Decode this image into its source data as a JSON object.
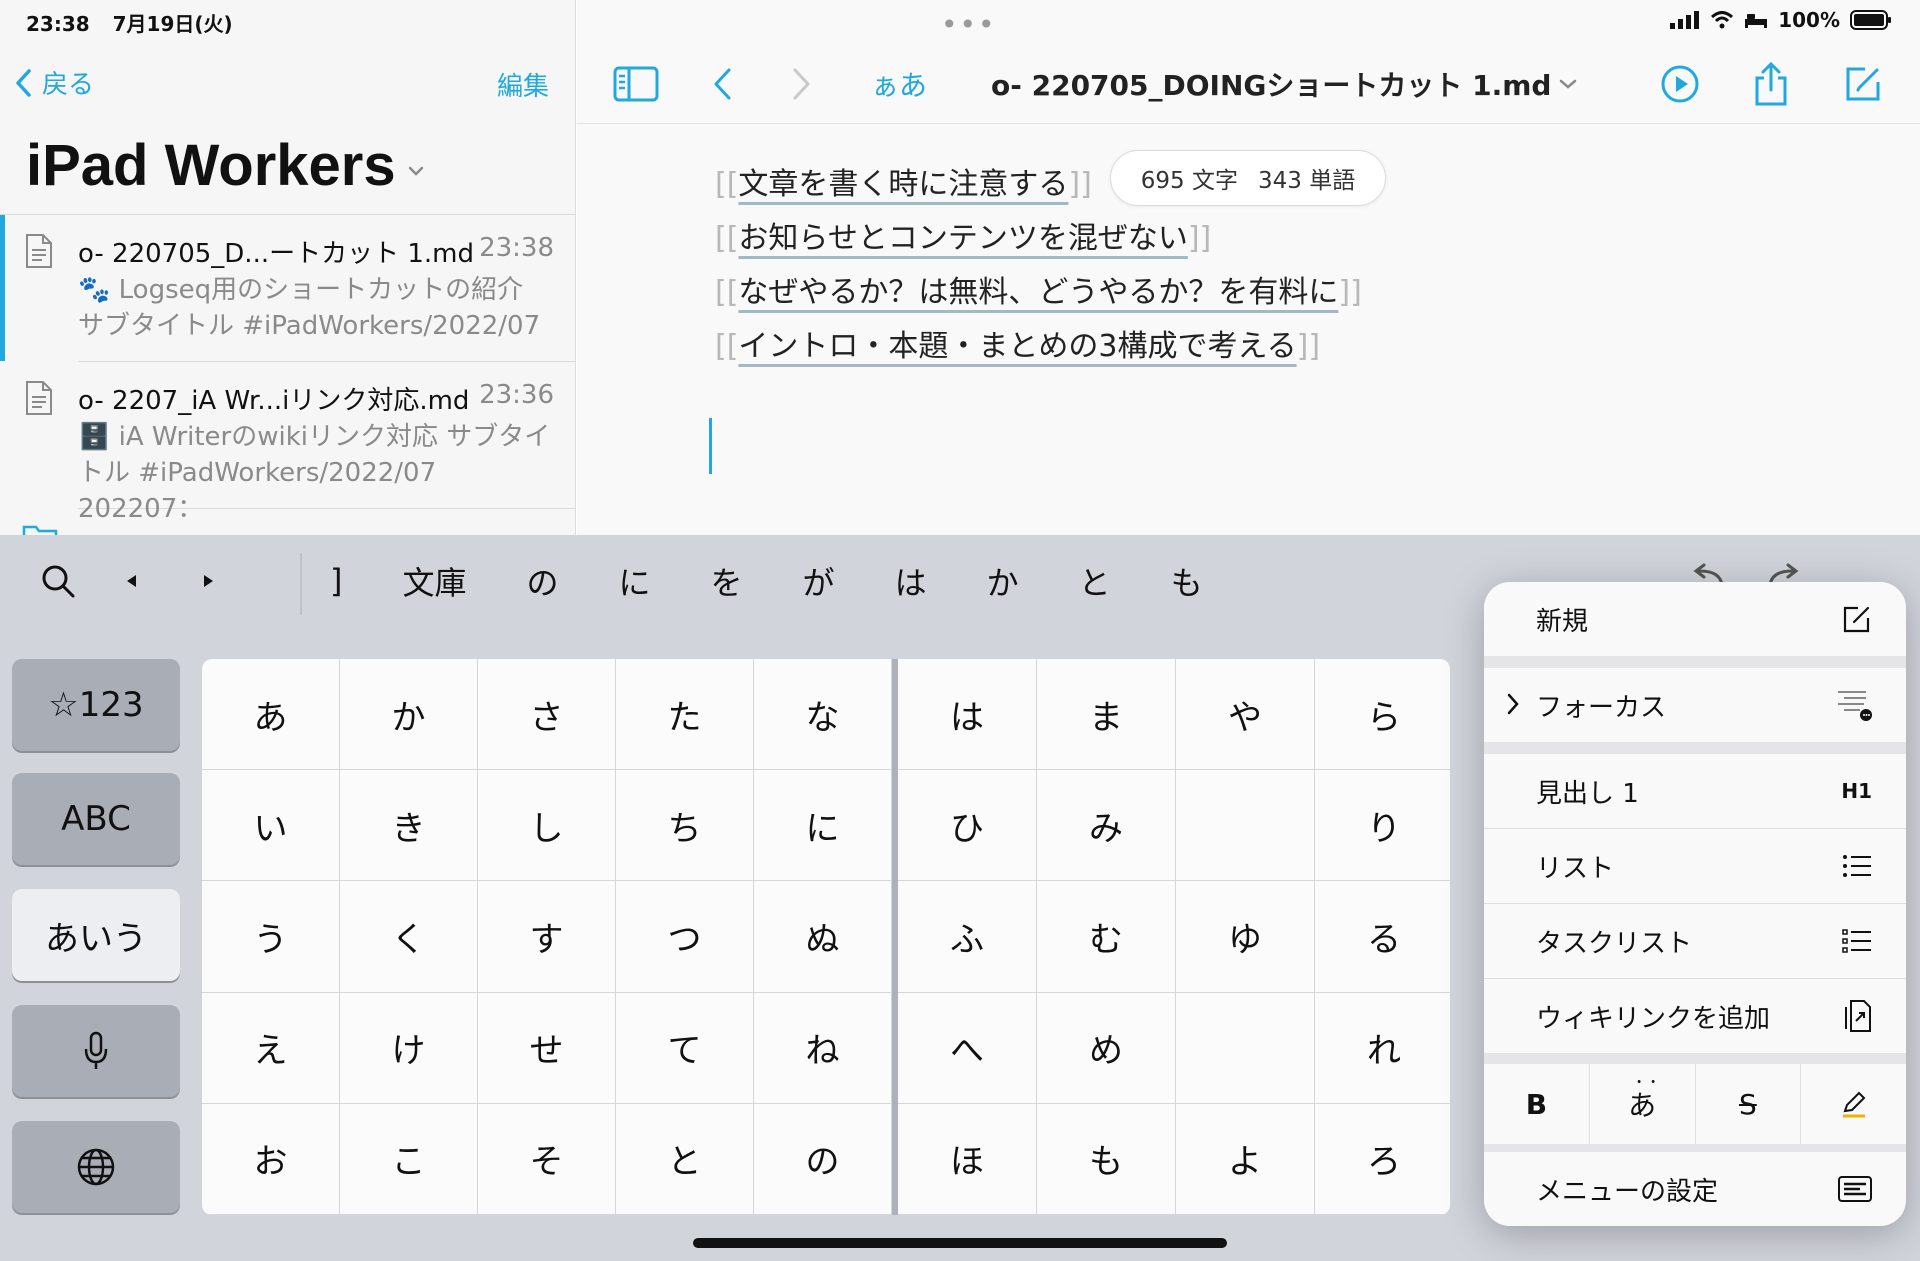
{
  "status": {
    "time": "23:38",
    "date": "7月19日(火)",
    "battery": "100%"
  },
  "sidebar": {
    "back_label": "戻る",
    "edit_label": "編集",
    "library_title": "iPad Workers",
    "files": [
      {
        "name": "o- 220705_D...ートカット 1.md",
        "time": "23:38",
        "preview": "🐾 Logseq用のショートカットの紹介\nサブタイトル #iPadWorkers/2022/07"
      },
      {
        "name": "o- 2207_iA Wr...iリンク対応.md",
        "time": "23:36",
        "preview": "🗄️ iA Writerのwikiリンク対応 サブタイ\nトル #iPadWorkers/2022/07 202207："
      }
    ]
  },
  "toolbar": {
    "aa_label": "ぁあ",
    "doc_title": "o- 220705_DOINGショートカット 1.md"
  },
  "editor": {
    "lines": [
      "文章を書く時に注意する",
      "お知らせとコンテンツを混ぜない",
      "なぜやるか？は無料、どうやるか？を有料に",
      "イントロ・本題・まとめの3構成で考える"
    ],
    "word_count": {
      "chars": "695 文字",
      "words": "343 単語"
    }
  },
  "keyboard": {
    "suggestions": [
      "]",
      "文庫",
      "の",
      "に",
      "を",
      "が",
      "は",
      "か",
      "と",
      "も"
    ],
    "left_keys": [
      "☆123",
      "ABC",
      "あいう"
    ],
    "kana_rows": [
      [
        "あ",
        "か",
        "さ",
        "た",
        "な",
        "は",
        "ま",
        "や",
        "ら"
      ],
      [
        "い",
        "き",
        "し",
        "ち",
        "に",
        "ひ",
        "み",
        "",
        "り"
      ],
      [
        "う",
        "く",
        "す",
        "つ",
        "ぬ",
        "ふ",
        "む",
        "ゆ",
        "る"
      ],
      [
        "え",
        "け",
        "せ",
        "て",
        "ね",
        "へ",
        "め",
        "",
        "れ"
      ],
      [
        "お",
        "こ",
        "そ",
        "と",
        "の",
        "ほ",
        "も",
        "よ",
        "ろ"
      ]
    ]
  },
  "menu": {
    "new_label": "新規",
    "focus_label": "フォーカス",
    "heading_label": "見出し 1",
    "heading_shortcut": "H1",
    "list_label": "リスト",
    "task_list_label": "タスクリスト",
    "wiki_link_label": "ウィキリンクを追加",
    "format": {
      "bold": "B",
      "kana": "あ",
      "strike": "S"
    },
    "settings_label": "メニューの設定"
  },
  "colors": {
    "accent": "#21a8de",
    "keyboard_bg": "#d1d4db",
    "sidebar_bg": "#f6f6f6"
  }
}
